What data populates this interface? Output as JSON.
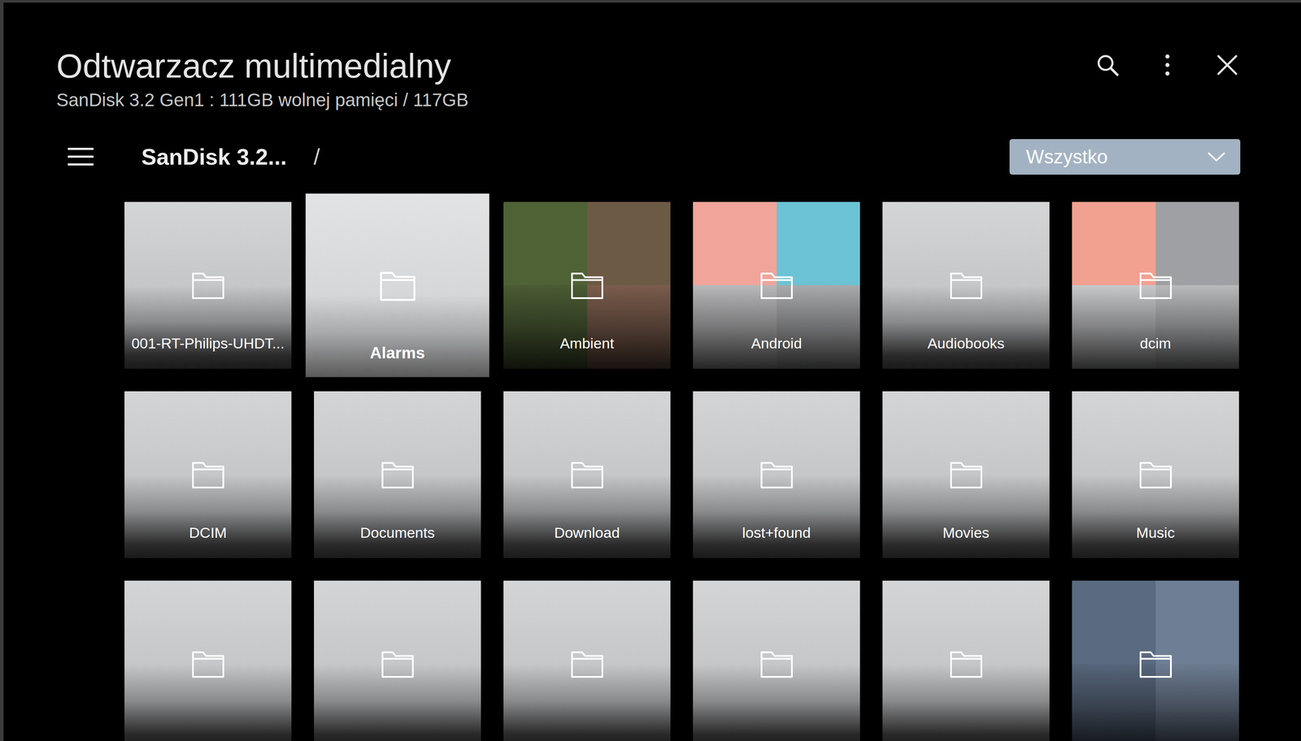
{
  "app": {
    "title": "Odtwarzacz multimedialny",
    "storage": "SanDisk 3.2 Gen1 : 111GB wolnej pamięci / 117GB"
  },
  "breadcrumb": {
    "path": "SanDisk 3.2...",
    "separator": "/"
  },
  "filter": {
    "value": "Wszystko"
  },
  "folders": [
    {
      "label": "001-RT-Philips-UHDT...",
      "selected": false,
      "kind": "plain"
    },
    {
      "label": "Alarms",
      "selected": true,
      "kind": "plain"
    },
    {
      "label": "Ambient",
      "selected": false,
      "kind": "preview",
      "thumbs": [
        "#4f6236",
        "#6d5a45",
        "#4a5b33",
        "#7a5c4c"
      ]
    },
    {
      "label": "Android",
      "selected": false,
      "kind": "preview",
      "thumbs": [
        "#f0a49a",
        "#6cc3d6",
        "#b8b8ba",
        "#a9aaac"
      ]
    },
    {
      "label": "Audiobooks",
      "selected": false,
      "kind": "plain"
    },
    {
      "label": "dcim",
      "selected": false,
      "kind": "preview",
      "thumbs": [
        "#f2a191",
        "#9ea0a3",
        "#c7c8ca",
        "#b8b9bb"
      ]
    },
    {
      "label": "DCIM",
      "selected": false,
      "kind": "plain"
    },
    {
      "label": "Documents",
      "selected": false,
      "kind": "plain"
    },
    {
      "label": "Download",
      "selected": false,
      "kind": "plain"
    },
    {
      "label": "lost+found",
      "selected": false,
      "kind": "plain"
    },
    {
      "label": "Movies",
      "selected": false,
      "kind": "plain"
    },
    {
      "label": "Music",
      "selected": false,
      "kind": "plain"
    },
    {
      "selected": false,
      "kind": "plain"
    },
    {
      "selected": false,
      "kind": "plain"
    },
    {
      "selected": false,
      "kind": "plain"
    },
    {
      "selected": false,
      "kind": "plain"
    },
    {
      "selected": false,
      "kind": "plain"
    },
    {
      "selected": false,
      "kind": "preview",
      "thumbs": [
        "#5a6a80",
        "#6e7f95",
        "#56657a",
        "#6c7b90"
      ]
    }
  ]
}
